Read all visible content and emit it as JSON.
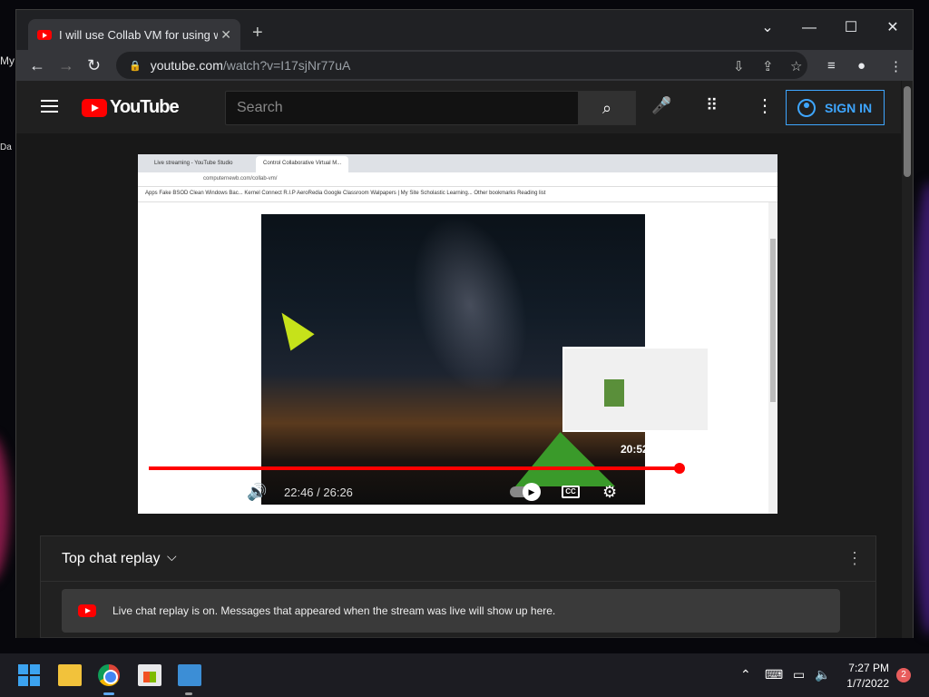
{
  "desktop": {
    "icon_label_1": "My",
    "icon_label_2": "Da"
  },
  "browser": {
    "tab": {
      "title": "I will use Collab VM for using wir",
      "close": "✕"
    },
    "new_tab": "+",
    "window_controls": {
      "tab_search": "⌄",
      "minimize": "—",
      "maximize": "☐",
      "close": "✕"
    },
    "nav": {
      "back": "←",
      "forward": "→",
      "reload": "↻"
    },
    "omnibox": {
      "host": "youtube.com",
      "path": "/watch?v=I17sjNr77uA",
      "lock": "🔒"
    },
    "omni_icons": {
      "install": "⇩",
      "share": "⇪",
      "bookmark": "☆"
    },
    "toolbar_icons": {
      "media": "≡",
      "profile": "●",
      "menu": "⋮"
    }
  },
  "youtube": {
    "logo_text": "YouTube",
    "search_placeholder": "Search",
    "search_icon": "⌕",
    "mic_icon": "🎤",
    "apps_icon": "⠿",
    "more_icon": "⋮",
    "signin_label": "SIGN IN"
  },
  "player": {
    "inner_browser": {
      "tab1": "Live streaming - YouTube Studio",
      "tab2": "Control Collaborative Virtual M...",
      "url": "computernewb.com/collab-vm/",
      "bookmarks": "Apps   Fake BSOD   Clean Windows Bac...   Kernel Connect   R.I.P AeroRedia   Google Classroom   Walpapers | My Site   Scholastic Learning...            Other bookmarks   Reading list"
    },
    "hover_time": "20:52",
    "time_display": "22:46 / 26:26",
    "progress": {
      "played_fraction": 0.861,
      "loaded_fraction": 0.936
    },
    "icons": {
      "pause": "❚❚",
      "next": "▶|",
      "volume": "🔊",
      "cc": "CC",
      "settings": "⚙",
      "miniplayer": "▣",
      "theater": "▭",
      "fullscreen": "⛶",
      "autoplay": "▶"
    }
  },
  "chat": {
    "title": "Top chat replay",
    "chevron": "⌵",
    "more": "⋮",
    "notice": "Live chat replay is on. Messages that appeared when the stream was live will show up here."
  },
  "taskbar": {
    "tray": {
      "chevron": "⌃",
      "keyboard": "⌨",
      "network": "▭",
      "volume": "🔈"
    },
    "time": "7:27 PM",
    "date": "1/7/2022",
    "notifications": "2"
  }
}
